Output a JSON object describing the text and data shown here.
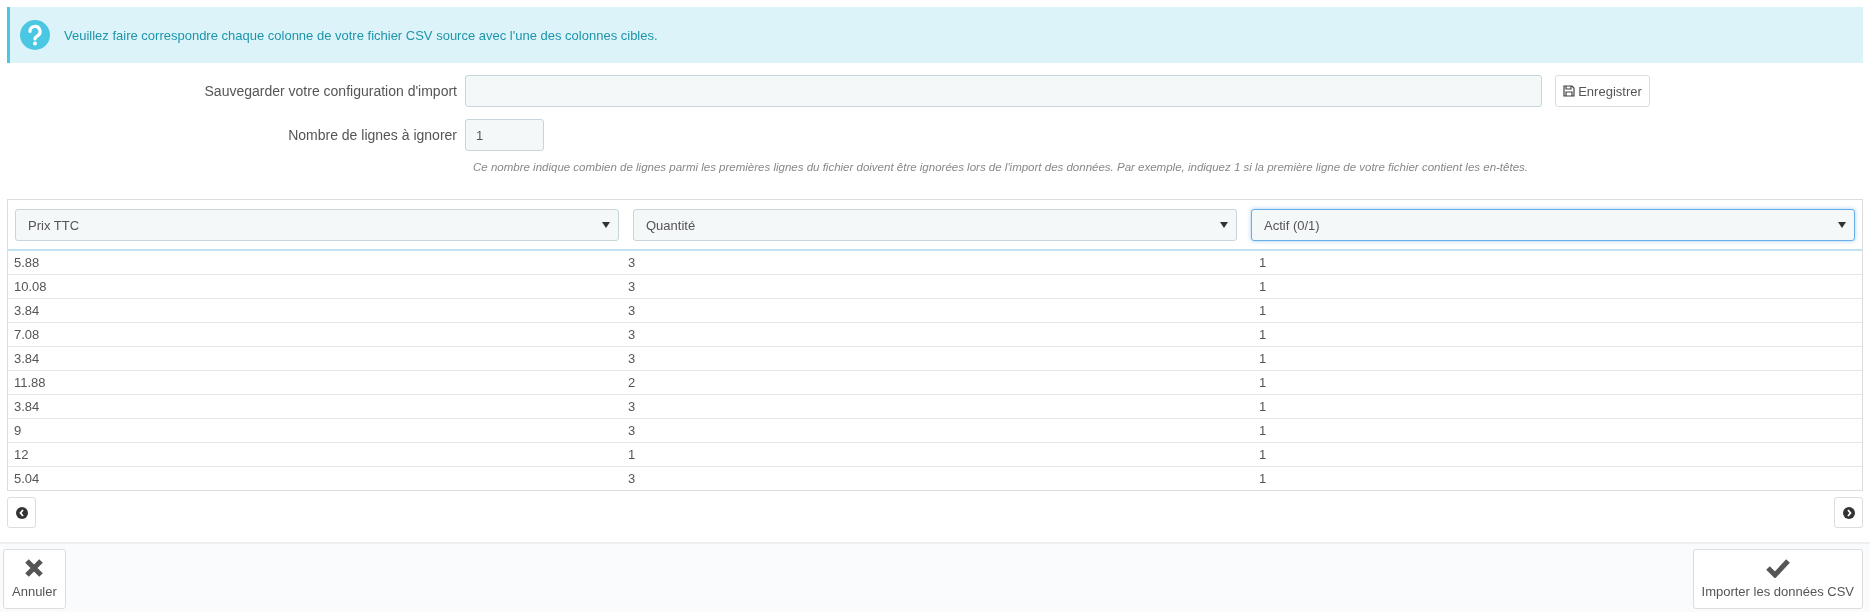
{
  "alert": {
    "text": "Veuillez faire correspondre chaque colonne de votre fichier CSV source avec l'une des colonnes cibles."
  },
  "form": {
    "save_label": "Sauvegarder votre configuration d'import",
    "save_button": "Enregistrer",
    "skip_label": "Nombre de lignes à ignorer",
    "skip_value": "1",
    "help": "Ce nombre indique combien de lignes parmi les premières lignes du fichier doivent être ignorées lors de l'import des données. Par exemple, indiquez 1 si la première ligne de votre fichier contient les en-têtes."
  },
  "table": {
    "columns": [
      {
        "label": "Prix TTC",
        "focused": false
      },
      {
        "label": "Quantité",
        "focused": false
      },
      {
        "label": "Actif (0/1)",
        "focused": true
      }
    ],
    "rows": [
      [
        "5.88",
        "3",
        "1"
      ],
      [
        "10.08",
        "3",
        "1"
      ],
      [
        "3.84",
        "3",
        "1"
      ],
      [
        "7.08",
        "3",
        "1"
      ],
      [
        "3.84",
        "3",
        "1"
      ],
      [
        "11.88",
        "2",
        "1"
      ],
      [
        "3.84",
        "3",
        "1"
      ],
      [
        "9",
        "3",
        "1"
      ],
      [
        "12",
        "1",
        "1"
      ],
      [
        "5.04",
        "3",
        "1"
      ]
    ]
  },
  "footer": {
    "cancel": "Annuler",
    "submit": "Importer les données CSV"
  }
}
